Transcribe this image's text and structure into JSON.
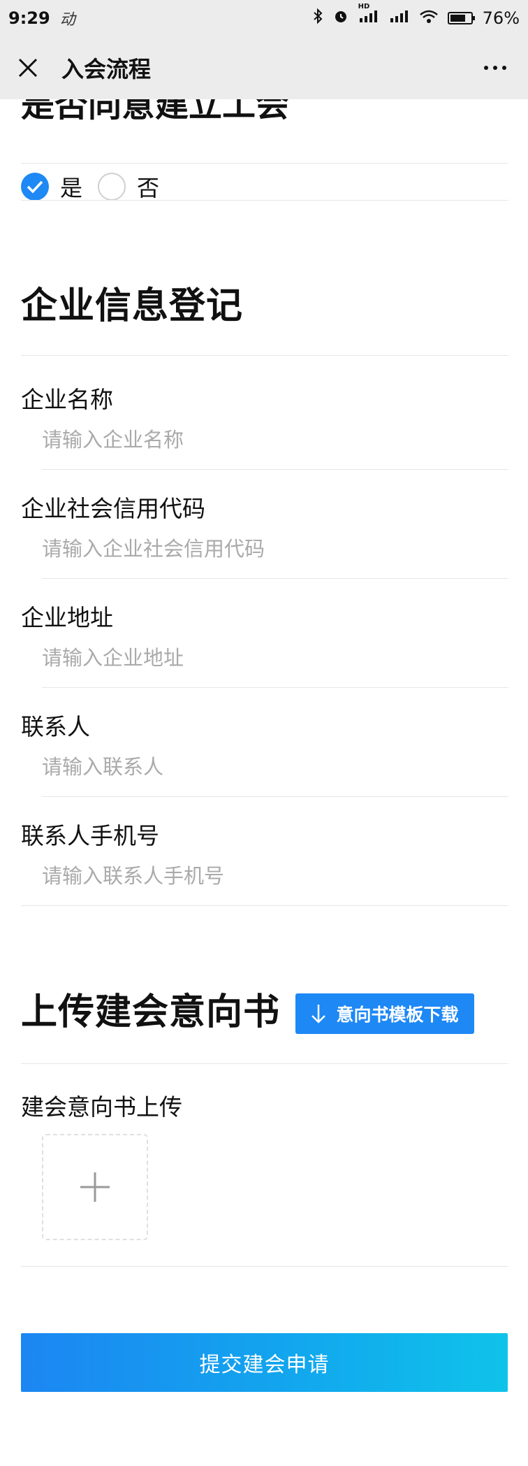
{
  "status_bar": {
    "time": "9:29",
    "activity": "动",
    "network": "HD",
    "battery": "76%",
    "battery_level": 0.76
  },
  "nav": {
    "title": "入会流程",
    "icons": [
      "close-icon",
      "more-icon"
    ]
  },
  "agree_section": {
    "heading": "是否同意建立工会",
    "options": [
      {
        "label": "是",
        "checked": true
      },
      {
        "label": "否",
        "checked": false
      }
    ]
  },
  "company_section": {
    "heading": "企业信息登记",
    "fields": [
      {
        "label": "企业名称",
        "placeholder": "请输入企业名称"
      },
      {
        "label": "企业社会信用代码",
        "placeholder": "请输入企业社会信用代码"
      },
      {
        "label": "企业地址",
        "placeholder": "请输入企业地址"
      },
      {
        "label": "联系人",
        "placeholder": "请输入联系人"
      },
      {
        "label": "联系人手机号",
        "placeholder": "请输入联系人手机号"
      }
    ]
  },
  "upload_section": {
    "heading": "上传建会意向书",
    "download_label": "意向书模板下载",
    "upload_label": "建会意向书上传"
  },
  "submit_label": "提交建会申请",
  "colors": {
    "primary": "#1e88f5",
    "gradient_end": "#0fc3ea",
    "nav_background": "#ececec"
  }
}
